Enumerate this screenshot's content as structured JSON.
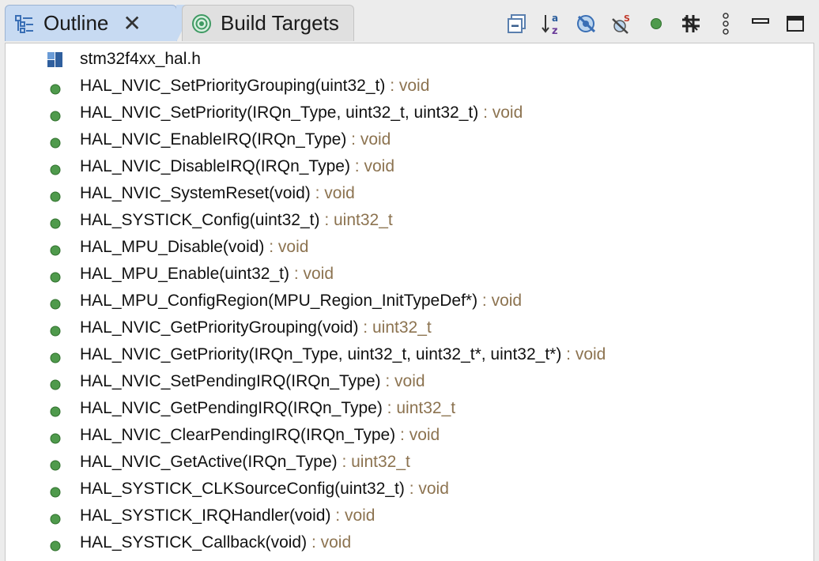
{
  "tabs": [
    {
      "label": "Outline",
      "active": true,
      "closable": true,
      "icon": "outline-icon"
    },
    {
      "label": "Build Targets",
      "active": false,
      "closable": false,
      "icon": "build-targets-icon"
    }
  ],
  "toolbar": {
    "buttons": [
      {
        "icon": "collapse-all-icon"
      },
      {
        "icon": "sort-alphabetical-icon"
      },
      {
        "icon": "hide-fields-icon"
      },
      {
        "icon": "hide-static-members-icon"
      },
      {
        "icon": "hide-non-public-icon"
      },
      {
        "icon": "group-includes-icon"
      },
      {
        "icon": "view-menu-icon"
      },
      {
        "icon": "minimize-icon"
      },
      {
        "icon": "maximize-icon"
      }
    ]
  },
  "outline": {
    "file": {
      "name": "stm32f4xx_hal.h",
      "icon": "header-file-icon"
    },
    "items": [
      {
        "sig": "HAL_NVIC_SetPriorityGrouping(uint32_t)",
        "ret": " : void"
      },
      {
        "sig": "HAL_NVIC_SetPriority(IRQn_Type, uint32_t, uint32_t)",
        "ret": " : void"
      },
      {
        "sig": "HAL_NVIC_EnableIRQ(IRQn_Type)",
        "ret": " : void"
      },
      {
        "sig": "HAL_NVIC_DisableIRQ(IRQn_Type)",
        "ret": " : void"
      },
      {
        "sig": "HAL_NVIC_SystemReset(void)",
        "ret": " : void"
      },
      {
        "sig": "HAL_SYSTICK_Config(uint32_t)",
        "ret": " : uint32_t"
      },
      {
        "sig": "HAL_MPU_Disable(void)",
        "ret": " : void"
      },
      {
        "sig": "HAL_MPU_Enable(uint32_t)",
        "ret": " : void"
      },
      {
        "sig": "HAL_MPU_ConfigRegion(MPU_Region_InitTypeDef*)",
        "ret": " : void"
      },
      {
        "sig": "HAL_NVIC_GetPriorityGrouping(void)",
        "ret": " : uint32_t"
      },
      {
        "sig": "HAL_NVIC_GetPriority(IRQn_Type, uint32_t, uint32_t*, uint32_t*)",
        "ret": " : void"
      },
      {
        "sig": "HAL_NVIC_SetPendingIRQ(IRQn_Type)",
        "ret": " : void"
      },
      {
        "sig": "HAL_NVIC_GetPendingIRQ(IRQn_Type)",
        "ret": " : uint32_t"
      },
      {
        "sig": "HAL_NVIC_ClearPendingIRQ(IRQn_Type)",
        "ret": " : void"
      },
      {
        "sig": "HAL_NVIC_GetActive(IRQn_Type)",
        "ret": " : uint32_t"
      },
      {
        "sig": "HAL_SYSTICK_CLKSourceConfig(uint32_t)",
        "ret": " : void"
      },
      {
        "sig": "HAL_SYSTICK_IRQHandler(void)",
        "ret": " : void"
      },
      {
        "sig": "HAL_SYSTICK_Callback(void)",
        "ret": " : void"
      }
    ]
  },
  "colors": {
    "active_tab": "#c7daf2",
    "return_type": "#8c7350",
    "function_dot": "#4f9a4c"
  }
}
